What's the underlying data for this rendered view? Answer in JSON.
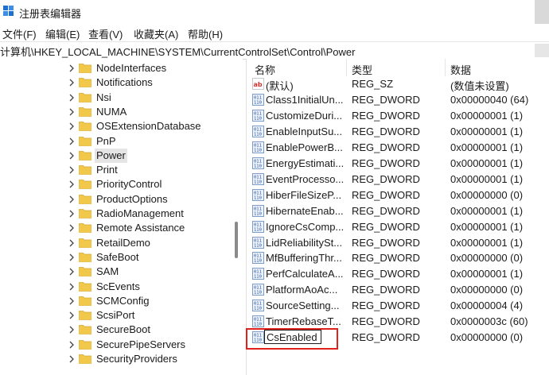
{
  "window": {
    "title": "注册表编辑器",
    "icon": "registry-editor-icon"
  },
  "menu": {
    "items": [
      {
        "label": "文件(F)"
      },
      {
        "label": "编辑(E)"
      },
      {
        "label": "查看(V)"
      },
      {
        "label": "收藏夹(A)"
      },
      {
        "label": "帮助(H)"
      }
    ]
  },
  "address": {
    "path": "计算机\\HKEY_LOCAL_MACHINE\\SYSTEM\\CurrentControlSet\\Control\\Power"
  },
  "tree": {
    "items": [
      {
        "label": "NodeInterfaces"
      },
      {
        "label": "Notifications"
      },
      {
        "label": "Nsi"
      },
      {
        "label": "NUMA"
      },
      {
        "label": "OSExtensionDatabase"
      },
      {
        "label": "PnP"
      },
      {
        "label": "Power",
        "selected": true
      },
      {
        "label": "Print"
      },
      {
        "label": "PriorityControl"
      },
      {
        "label": "ProductOptions"
      },
      {
        "label": "RadioManagement"
      },
      {
        "label": "Remote Assistance"
      },
      {
        "label": "RetailDemo"
      },
      {
        "label": "SafeBoot"
      },
      {
        "label": "SAM"
      },
      {
        "label": "ScEvents"
      },
      {
        "label": "SCMConfig"
      },
      {
        "label": "ScsiPort"
      },
      {
        "label": "SecureBoot"
      },
      {
        "label": "SecurePipeServers"
      },
      {
        "label": "SecurityProviders"
      }
    ]
  },
  "list": {
    "columns": {
      "name": "名称",
      "type": "类型",
      "data": "数据"
    },
    "rows": [
      {
        "icon": "string-value-icon",
        "name": "(默认)",
        "type": "REG_SZ",
        "data": "(数值未设置)"
      },
      {
        "icon": "dword-value-icon",
        "name": "Class1InitialUn...",
        "type": "REG_DWORD",
        "data": "0x00000040 (64)"
      },
      {
        "icon": "dword-value-icon",
        "name": "CustomizeDuri...",
        "type": "REG_DWORD",
        "data": "0x00000001 (1)"
      },
      {
        "icon": "dword-value-icon",
        "name": "EnableInputSu...",
        "type": "REG_DWORD",
        "data": "0x00000001 (1)"
      },
      {
        "icon": "dword-value-icon",
        "name": "EnablePowerB...",
        "type": "REG_DWORD",
        "data": "0x00000001 (1)"
      },
      {
        "icon": "dword-value-icon",
        "name": "EnergyEstimati...",
        "type": "REG_DWORD",
        "data": "0x00000001 (1)"
      },
      {
        "icon": "dword-value-icon",
        "name": "EventProcesso...",
        "type": "REG_DWORD",
        "data": "0x00000001 (1)"
      },
      {
        "icon": "dword-value-icon",
        "name": "HiberFileSizeP...",
        "type": "REG_DWORD",
        "data": "0x00000000 (0)"
      },
      {
        "icon": "dword-value-icon",
        "name": "HibernateEnab...",
        "type": "REG_DWORD",
        "data": "0x00000001 (1)"
      },
      {
        "icon": "dword-value-icon",
        "name": "IgnoreCsComp...",
        "type": "REG_DWORD",
        "data": "0x00000001 (1)"
      },
      {
        "icon": "dword-value-icon",
        "name": "LidReliabilitySt...",
        "type": "REG_DWORD",
        "data": "0x00000001 (1)"
      },
      {
        "icon": "dword-value-icon",
        "name": "MfBufferingThr...",
        "type": "REG_DWORD",
        "data": "0x00000000 (0)"
      },
      {
        "icon": "dword-value-icon",
        "name": "PerfCalculateA...",
        "type": "REG_DWORD",
        "data": "0x00000001 (1)"
      },
      {
        "icon": "dword-value-icon",
        "name": "PlatformAoAc...",
        "type": "REG_DWORD",
        "data": "0x00000000 (0)"
      },
      {
        "icon": "dword-value-icon",
        "name": "SourceSetting...",
        "type": "REG_DWORD",
        "data": "0x00000004 (4)"
      },
      {
        "icon": "dword-value-icon",
        "name": "TimerRebaseT...",
        "type": "REG_DWORD",
        "data": "0x0000003c (60)"
      }
    ],
    "editing_row": {
      "icon": "dword-value-icon",
      "name": "CsEnabled",
      "type": "REG_DWORD",
      "data": "0x00000000 (0)"
    }
  },
  "colors": {
    "highlight": "#e0201a",
    "folder": "#f2c84b",
    "selection": "#e5e5e5"
  }
}
